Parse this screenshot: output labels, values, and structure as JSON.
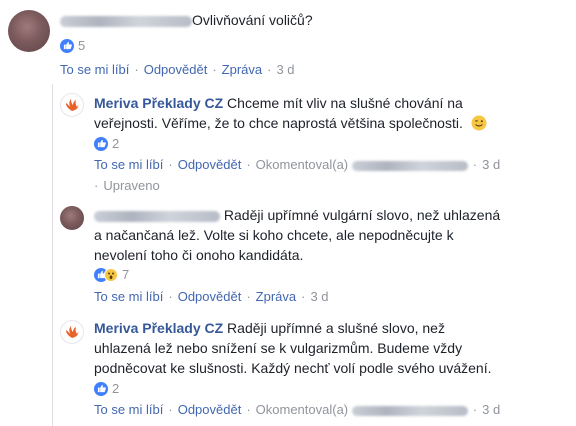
{
  "comment1": {
    "text": "Ovlivňování voličů?",
    "like_count": "5",
    "actions": {
      "like": "To se mi líbí",
      "reply": "Odpovědět",
      "message": "Zpráva",
      "time": "3 d"
    }
  },
  "reply1": {
    "author": "Meriva Překlady CZ",
    "text_line1": " Chceme mít vliv na slušné chování na",
    "text_line2": "veřejnosti. Věříme, že to chce naprostá většina společnosti.",
    "like_count": "2",
    "actions": {
      "like": "To se mi líbí",
      "reply": "Odpovědět",
      "commented": "Okomentoval(a)",
      "time": "3 d",
      "edited": "Upraveno"
    }
  },
  "reply2": {
    "text_line1": "Raději upřímné vulgární slovo, než uhlazená",
    "text_line2": "a načančaná lež. Volte si koho chcete, ale nepodněcujte k",
    "text_line3": "nevolení toho či onoho kandidáta.",
    "reaction_count": "7",
    "actions": {
      "like": "To se mi líbí",
      "reply": "Odpovědět",
      "message": "Zpráva",
      "time": "3 d"
    }
  },
  "reply3": {
    "author": "Meriva Překlady CZ",
    "text_line1": " Raději upřímné a slušné slovo, než",
    "text_line2": "uhlazená lež nebo snížení se k vulgarizmům. Budeme vždy",
    "text_line3": "podněcovat ke slušnosti. Každý nechť volí podle svého uvážení.",
    "like_count": "2",
    "actions": {
      "like": "To se mi líbí",
      "reply": "Odpovědět",
      "commented": "Okomentoval(a)",
      "time": "3 d"
    }
  },
  "colors": {
    "link": "#4267b2",
    "author": "#365899",
    "meta": "#90949c",
    "like_blue": "#4080ff",
    "logo_red": "#e8632a"
  },
  "icons": {
    "like": "like-icon",
    "wow": "wow-icon",
    "wink": "wink-emoji",
    "logo": "meriva-logo"
  }
}
